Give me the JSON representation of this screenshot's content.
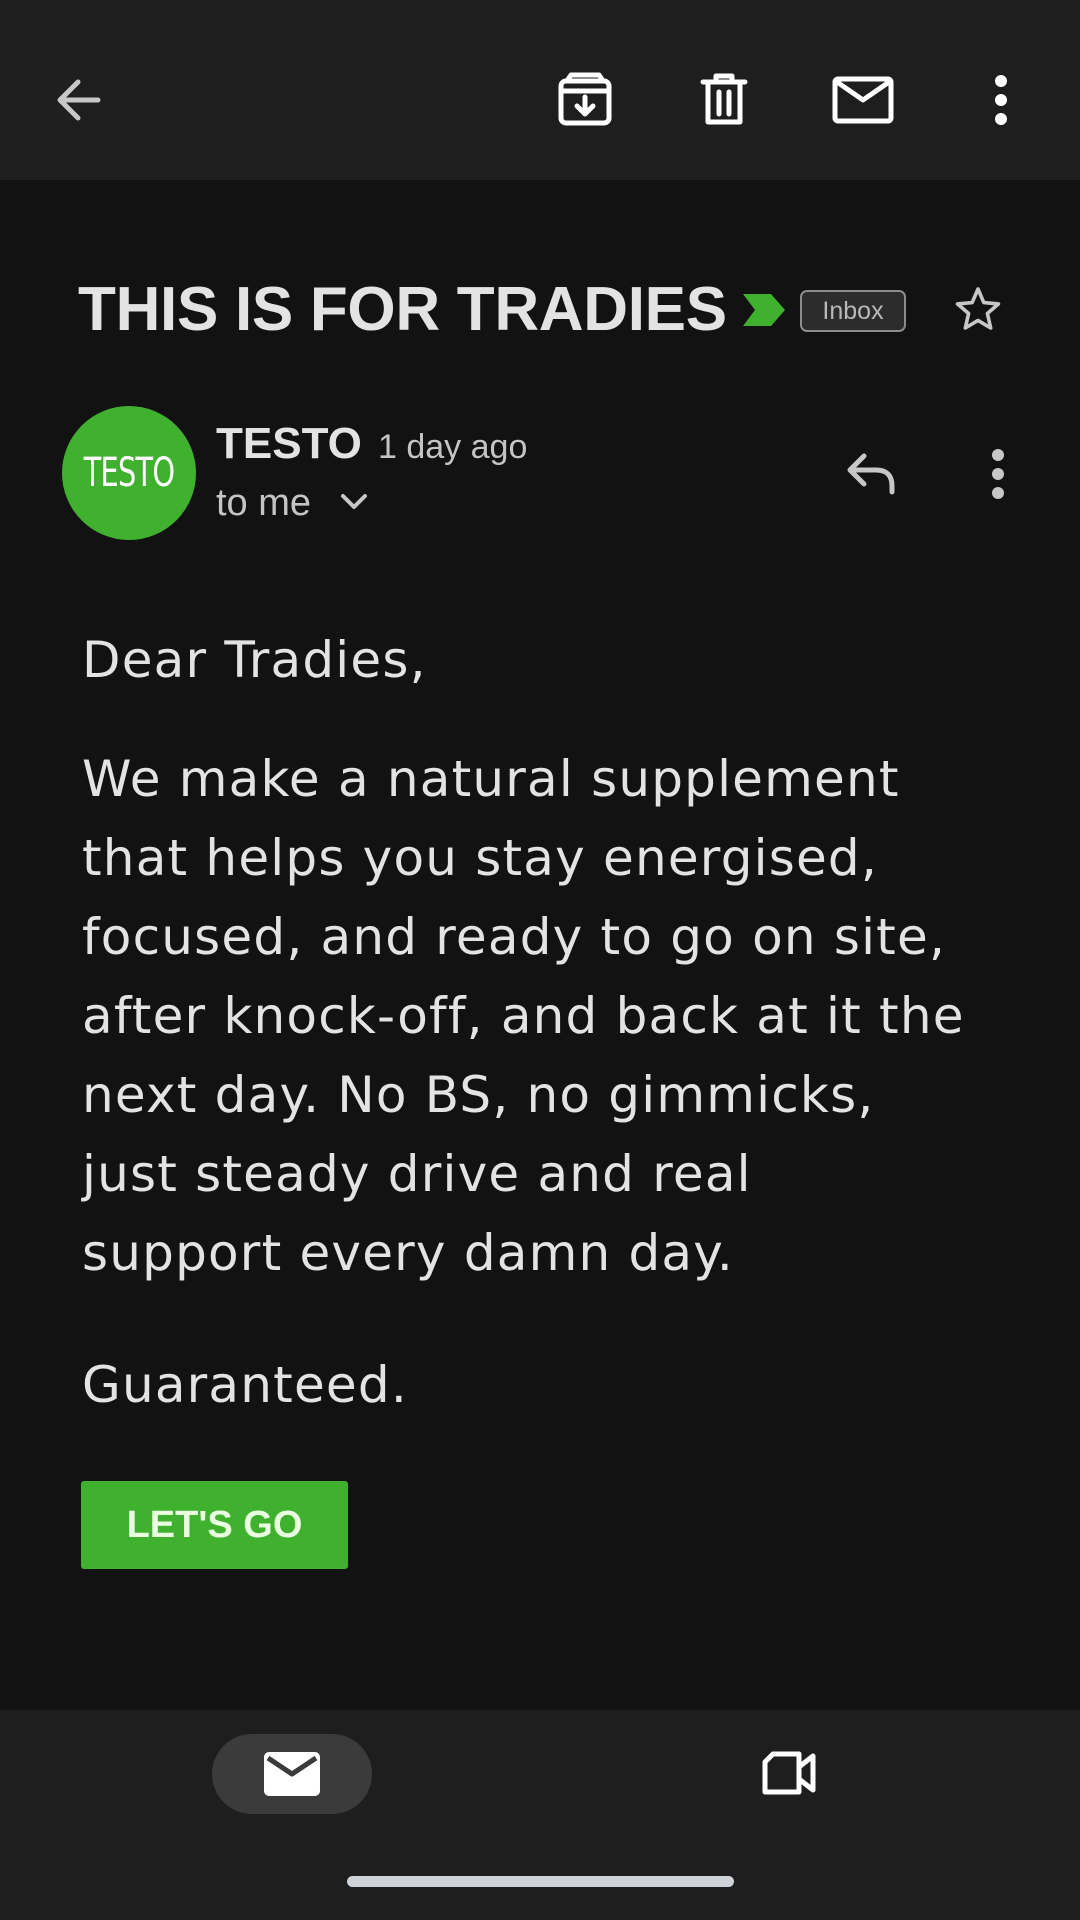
{
  "toolbar": {
    "back": "back-arrow-icon",
    "archive": "archive-icon",
    "delete": "delete-icon",
    "mark_unread": "mail-icon",
    "more": "more-vert-icon"
  },
  "email": {
    "subject": "THIS IS FOR TRADIES",
    "label": "Inbox",
    "important_color": "#40b02f",
    "sender": {
      "avatar_text": "TESTO",
      "avatar_color": "#40b02f",
      "name": "TESTO",
      "time": "1 day ago",
      "recipient": "to me"
    },
    "body": {
      "greeting": "Dear Tradies,",
      "lines": [
        "We make a natural supplement",
        "that helps you stay energised,",
        "focused, and ready to go on site,",
        "after knock-off, and back at it the",
        "next day. No BS, no gimmicks,",
        "just steady drive and real",
        "support every damn day."
      ],
      "closing": "Guaranteed.",
      "cta_label": "LET'S GO"
    }
  },
  "bottom_nav": {
    "mail": "mail-icon",
    "meet": "video-camera-icon"
  }
}
